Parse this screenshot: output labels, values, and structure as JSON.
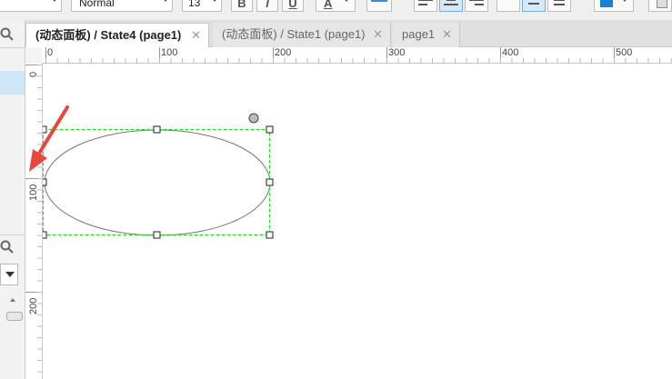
{
  "toolbar": {
    "font_style_value": "Normal",
    "font_size_value": "13",
    "bold_label": "B",
    "italic_label": "I",
    "underline_label": "U",
    "font_color_label": "A"
  },
  "tabs": [
    {
      "label": "(动态面板) / State4 (page1)",
      "close": "✕",
      "active": true
    },
    {
      "label": "(动态面板) / State1 (page1)",
      "close": "✕",
      "active": false
    },
    {
      "label": "page1",
      "close": "✕",
      "active": false
    }
  ],
  "ruler": {
    "top_labels": [
      "0",
      "100",
      "200",
      "300",
      "400",
      "500"
    ],
    "left_labels": [
      "0",
      "100",
      "200"
    ]
  },
  "colors": {
    "selection_border": "#22dd22",
    "ellipse_stroke": "#777777",
    "arrow": "#e8473b",
    "active_toggle": "#d6e9fb",
    "fill_swatch": "#1e7fd6"
  }
}
